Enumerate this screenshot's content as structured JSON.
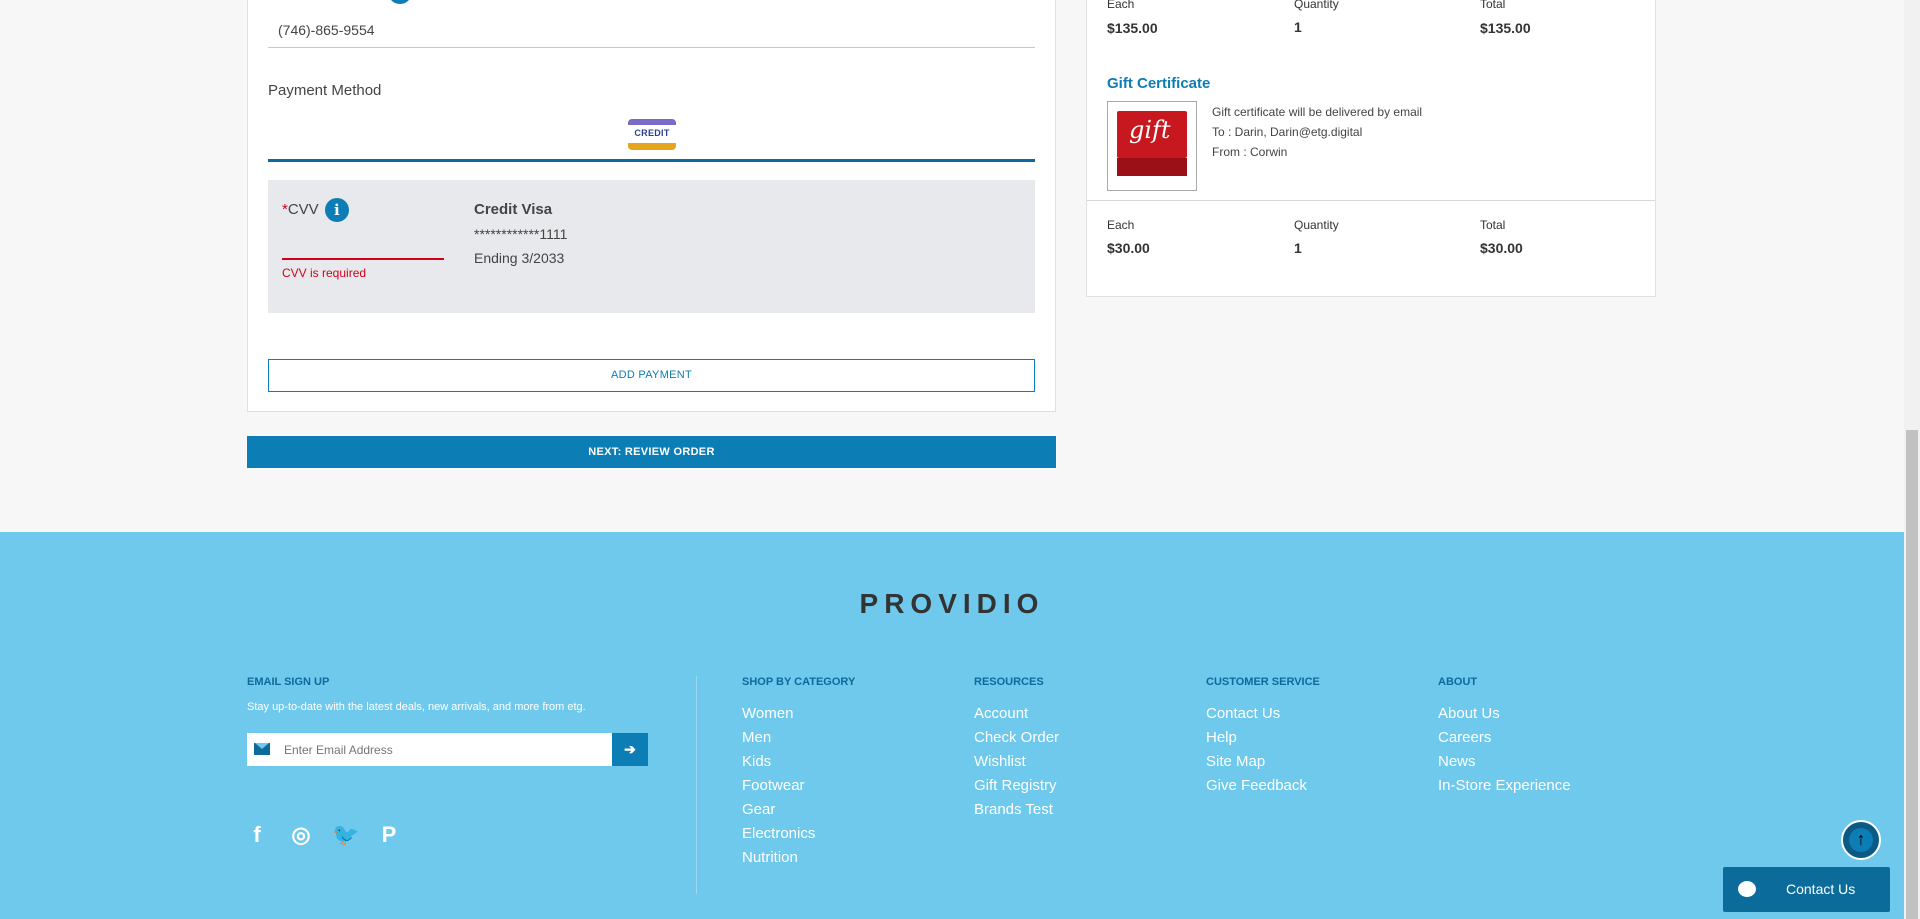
{
  "checkout": {
    "phone_value": "(746)-865-9554",
    "payment_method_title": "Payment Method",
    "payment_tab_label": "CREDIT",
    "cvv_label": "CVV",
    "cvv_required_marker": "*",
    "cvv_info": "i",
    "cvv_error": "CVV is required",
    "card_type": "Credit Visa",
    "card_number": "************1111",
    "card_expiry": "Ending 3/2033",
    "add_payment_label": "ADD PAYMENT",
    "next_label": "NEXT: REVIEW ORDER"
  },
  "summary": {
    "item1": {
      "each_label": "Each",
      "each_value": "$135.00",
      "qty_label": "Quantity",
      "qty_value": "1",
      "total_label": "Total",
      "total_value": "$135.00"
    },
    "gift": {
      "title": "Gift Certificate",
      "thumb_text": "gift",
      "line1": "Gift certificate will be delivered by email",
      "line2": "To : Darin, Darin@etg.digital",
      "line3": "From : Corwin"
    },
    "item2": {
      "each_label": "Each",
      "each_value": "$30.00",
      "qty_label": "Quantity",
      "qty_value": "1",
      "total_label": "Total",
      "total_value": "$30.00"
    }
  },
  "footer": {
    "brand": "PROVIDIO",
    "email_heading": "EMAIL SIGN UP",
    "email_sub": "Stay up-to-date with the latest deals, new arrivals, and more from etg.",
    "email_placeholder": "Enter Email Address",
    "email_go": "➔",
    "social": {
      "facebook": "f",
      "instagram": "◎",
      "twitter": "🐦",
      "pinterest": "P"
    },
    "columns": [
      {
        "heading": "SHOP BY CATEGORY",
        "links": [
          "Women",
          "Men",
          "Kids",
          "Footwear",
          "Gear",
          "Electronics",
          "Nutrition"
        ]
      },
      {
        "heading": "RESOURCES",
        "links": [
          "Account",
          "Check Order",
          "Wishlist",
          "Gift Registry",
          "Brands Test"
        ]
      },
      {
        "heading": "CUSTOMER SERVICE",
        "links": [
          "Contact Us",
          "Help",
          "Site Map",
          "Give Feedback"
        ]
      },
      {
        "heading": "ABOUT",
        "links": [
          "About Us",
          "Careers",
          "News",
          "In-Store Experience"
        ]
      }
    ],
    "scroll_top": "↑",
    "chat_label": "Contact Us"
  },
  "colors": {
    "accent": "#0d7db5",
    "footer_bg": "#6ec9ec",
    "error": "#d0021b"
  }
}
